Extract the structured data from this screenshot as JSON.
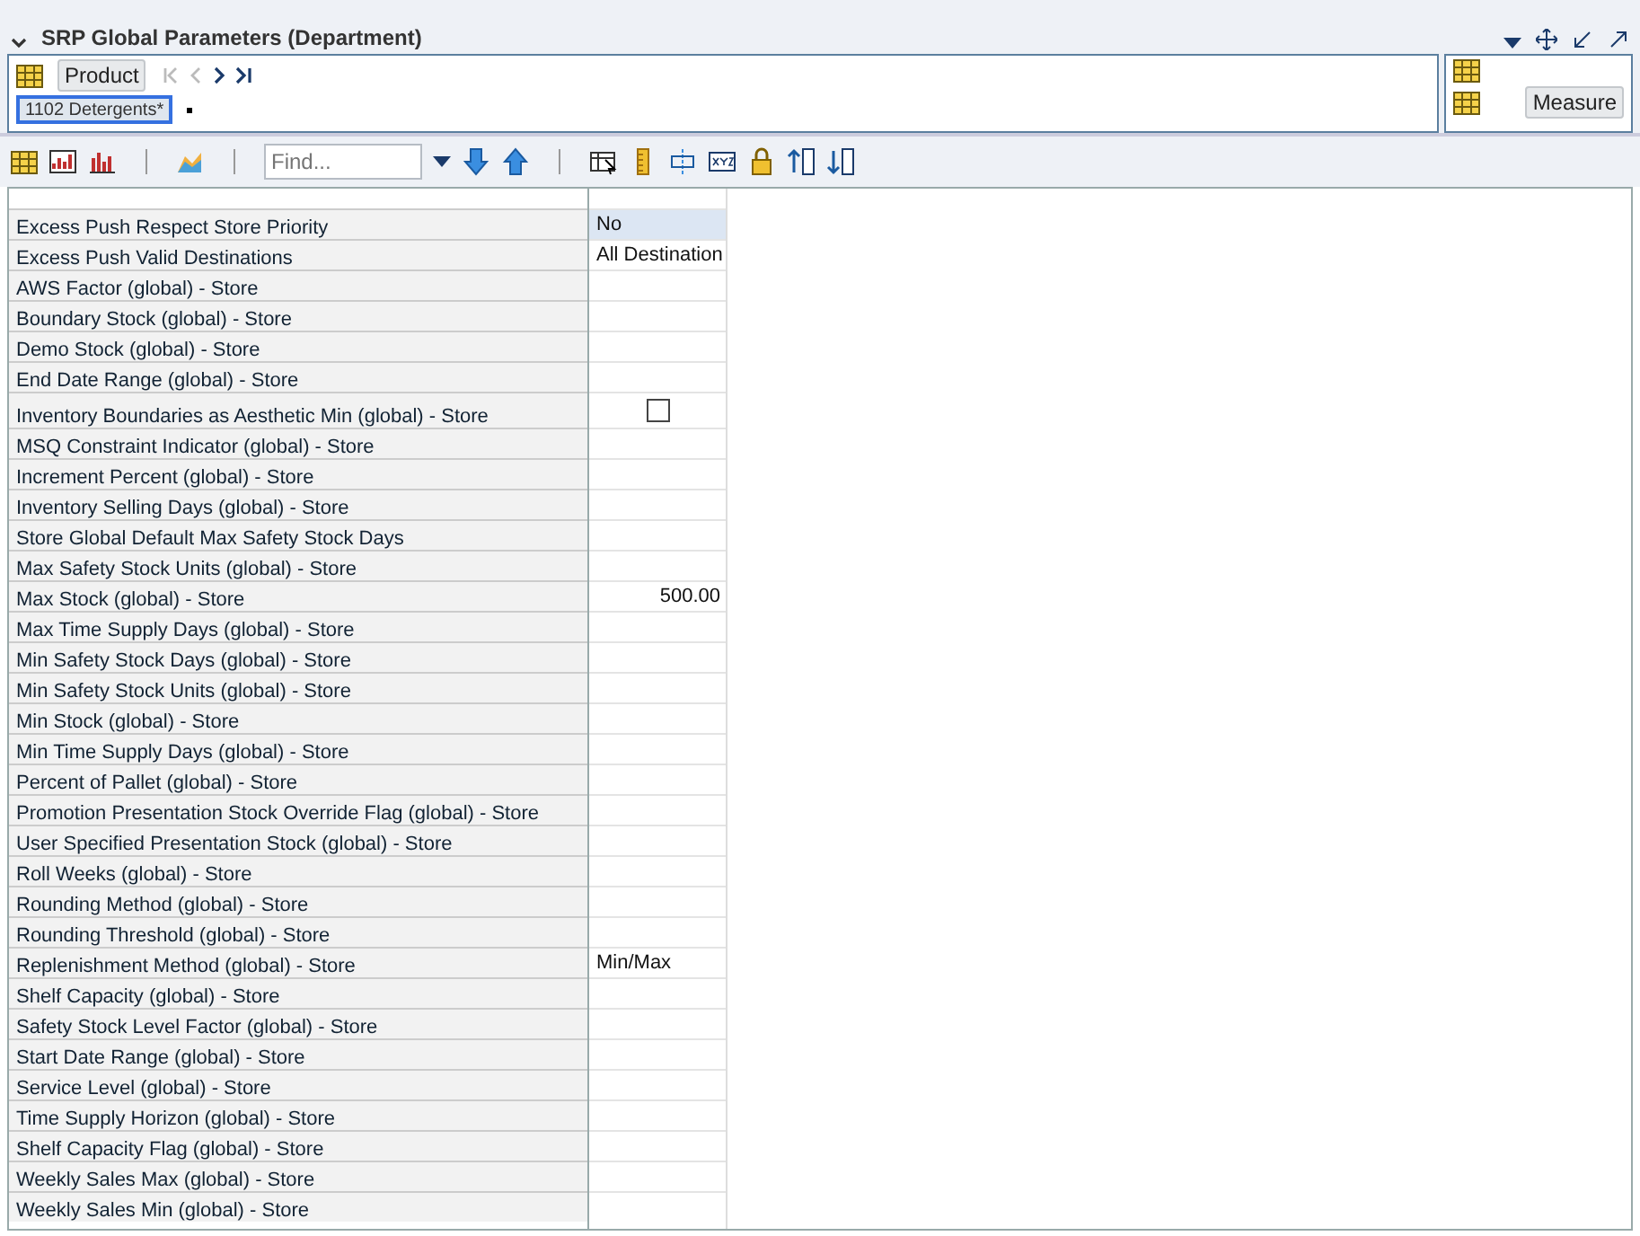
{
  "title": "SRP Global Parameters (Department)",
  "product": {
    "label": "Product",
    "tile": "1102 Detergents*"
  },
  "measure": {
    "label": "Measure"
  },
  "find": {
    "placeholder": "Find..."
  },
  "rows": [
    {
      "label": "Excess Push Respect Store Priority",
      "kind": "text",
      "value": "No",
      "selected": true
    },
    {
      "label": "Excess Push Valid Destinations",
      "kind": "text",
      "value": "All Destination",
      "selected": false
    },
    {
      "label": "AWS Factor (global) - Store",
      "kind": "text",
      "selected": false
    },
    {
      "label": "Boundary Stock (global) - Store",
      "kind": "text",
      "selected": false
    },
    {
      "label": "Demo Stock (global) - Store",
      "kind": "text",
      "selected": false
    },
    {
      "label": "End Date Range (global) - Store",
      "kind": "text",
      "selected": false
    },
    {
      "label": "Inventory Boundaries as Aesthetic Min (global) - Store",
      "kind": "checkbox",
      "checked": false,
      "selected": false
    },
    {
      "label": "MSQ Constraint Indicator (global) - Store",
      "kind": "text",
      "selected": false
    },
    {
      "label": "Increment Percent (global) - Store",
      "kind": "text",
      "selected": false
    },
    {
      "label": "Inventory Selling Days (global) - Store",
      "kind": "text",
      "selected": false
    },
    {
      "label": "Store Global Default Max Safety Stock Days",
      "kind": "text",
      "selected": false
    },
    {
      "label": "Max Safety Stock Units (global) - Store",
      "kind": "text",
      "selected": false
    },
    {
      "label": "Max Stock (global) - Store",
      "kind": "number",
      "value": "500.00",
      "selected": false
    },
    {
      "label": "Max Time Supply Days (global) - Store",
      "kind": "text",
      "selected": false
    },
    {
      "label": "Min Safety Stock Days (global) - Store",
      "kind": "text",
      "selected": false
    },
    {
      "label": "Min Safety Stock Units (global) - Store",
      "kind": "text",
      "selected": false
    },
    {
      "label": "Min Stock (global) - Store",
      "kind": "text",
      "selected": false
    },
    {
      "label": "Min Time Supply Days (global) - Store",
      "kind": "text",
      "selected": false
    },
    {
      "label": "Percent of Pallet (global) - Store",
      "kind": "text",
      "selected": false
    },
    {
      "label": "Promotion Presentation Stock Override Flag (global) - Store",
      "kind": "text",
      "selected": false
    },
    {
      "label": "User Specified Presentation Stock (global) - Store",
      "kind": "text",
      "selected": false
    },
    {
      "label": "Roll Weeks (global) - Store",
      "kind": "text",
      "selected": false
    },
    {
      "label": "Rounding Method (global) - Store",
      "kind": "text",
      "selected": false
    },
    {
      "label": "Rounding Threshold (global) - Store",
      "kind": "text",
      "selected": false
    },
    {
      "label": "Replenishment Method (global) - Store",
      "kind": "text",
      "value": "Min/Max",
      "selected": false
    },
    {
      "label": "Shelf Capacity (global) - Store",
      "kind": "text",
      "selected": false
    },
    {
      "label": "Safety Stock Level Factor (global) - Store",
      "kind": "text",
      "selected": false
    },
    {
      "label": "Start Date Range (global) - Store",
      "kind": "text",
      "selected": false
    },
    {
      "label": "Service Level (global) - Store",
      "kind": "text",
      "selected": false
    },
    {
      "label": "Time Supply Horizon (global) - Store",
      "kind": "text",
      "selected": false
    },
    {
      "label": "Shelf Capacity Flag (global) - Store",
      "kind": "text",
      "selected": false
    },
    {
      "label": "Weekly Sales Max (global) - Store",
      "kind": "text",
      "selected": false
    },
    {
      "label": "Weekly Sales Min (global) - Store",
      "kind": "text",
      "selected": false
    }
  ]
}
